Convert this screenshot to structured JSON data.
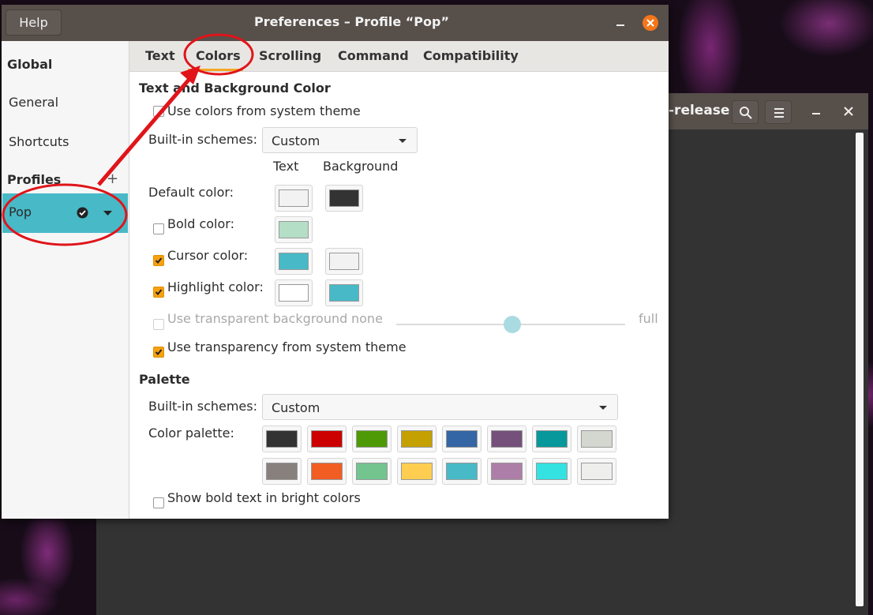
{
  "terminal": {
    "title": "-release",
    "scrollbar_color": "#f6f6f6"
  },
  "prefs": {
    "help_label": "Help",
    "title": "Preferences – Profile “Pop”",
    "minimize_glyph": "_",
    "sidebar": {
      "global_heading": "Global",
      "items": [
        "General",
        "Shortcuts"
      ],
      "profiles_heading": "Profiles",
      "add_glyph": "+",
      "profile": {
        "name": "Pop",
        "selected_color": "#48b9c7"
      }
    },
    "tabs": [
      "Text",
      "Colors",
      "Scrolling",
      "Command",
      "Compatibility"
    ],
    "active_tab": "Colors",
    "accent": "#f5a623",
    "colors": {
      "section_title": "Text and Background Color",
      "use_system_theme": {
        "label": "Use colors from system theme",
        "checked": false
      },
      "builtin_label": "Built-in schemes:",
      "builtin_value": "Custom",
      "col_text": "Text",
      "col_background": "Background",
      "default_label": "Default color:",
      "default_text_color": "#f2f2f2",
      "default_bg_color": "#333333",
      "bold_label": "Bold color:",
      "bold_checked": false,
      "bold_color": "#b4dec6",
      "cursor_label": "Cursor color:",
      "cursor_checked": true,
      "cursor_fg": "#48b9c7",
      "cursor_bg": "#f2f2f2",
      "highlight_label": "Highlight color:",
      "highlight_checked": true,
      "highlight_fg": "#ffffff",
      "highlight_bg": "#48b9c7",
      "transparent_label": "Use transparent background",
      "transparent_checked": false,
      "transparent_min": "none",
      "transparent_max": "full",
      "transparent_level": 0.5,
      "system_transparency_label": "Use transparency from system theme",
      "system_transparency_checked": true
    },
    "palette": {
      "section_title": "Palette",
      "builtin_label": "Built-in schemes:",
      "builtin_value": "Custom",
      "palette_label": "Color palette:",
      "row1": [
        "#333333",
        "#cc0000",
        "#4e9a06",
        "#c4a000",
        "#3465a4",
        "#75507b",
        "#06989a",
        "#d3d7cf"
      ],
      "row2": [
        "#88807c",
        "#f15d22",
        "#73c48f",
        "#ffce51",
        "#48b9c7",
        "#ad7fa8",
        "#34e2e2",
        "#eeeeec"
      ],
      "bright_bold_label": "Show bold text in bright colors",
      "bright_bold_checked": false
    }
  }
}
